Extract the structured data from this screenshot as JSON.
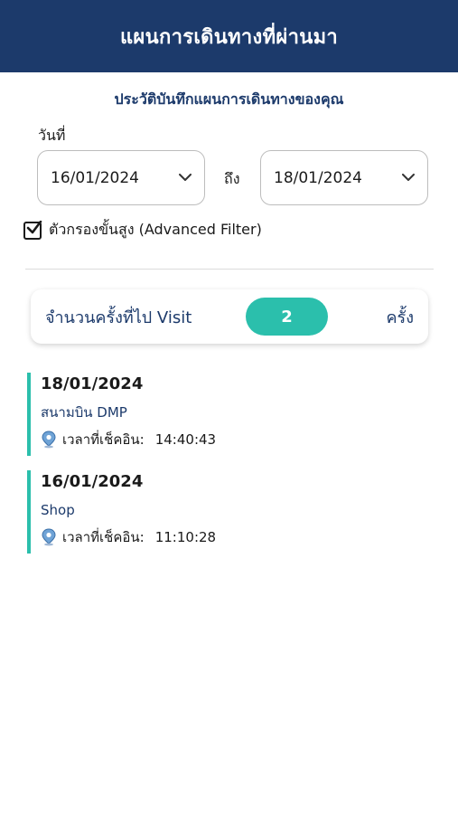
{
  "header": {
    "title": "แผนการเดินทางที่ผ่านมา"
  },
  "subtitle": "ประวัติบันทึกแผนการเดินทางของคุณ",
  "filter": {
    "date_label": "วันที่",
    "from_date": "16/01/2024",
    "to_label": "ถึง",
    "to_date": "18/01/2024",
    "advanced_filter_label": "ตัวกรองขั้นสูง (Advanced Filter)",
    "advanced_filter_checked": true
  },
  "visit_summary": {
    "label": "จำนวนครั้งที่ไป Visit",
    "count": "2",
    "unit": "ครั้ง"
  },
  "entries": [
    {
      "date": "18/01/2024",
      "place": "สนามบิน DMP",
      "checkin_label": "เวลาที่เช็คอิน:",
      "checkin_time": "14:40:43"
    },
    {
      "date": "16/01/2024",
      "place": "Shop",
      "checkin_label": "เวลาที่เช็คอิน:",
      "checkin_time": "11:10:28"
    }
  ],
  "colors": {
    "header_bg": "#1c3a6b",
    "accent": "#2bbfac",
    "primary_text": "#1c3a6b"
  },
  "icons": {
    "dropdown": "chevron-down-icon",
    "checkbox": "check-icon",
    "checkin": "location-pin-icon"
  }
}
